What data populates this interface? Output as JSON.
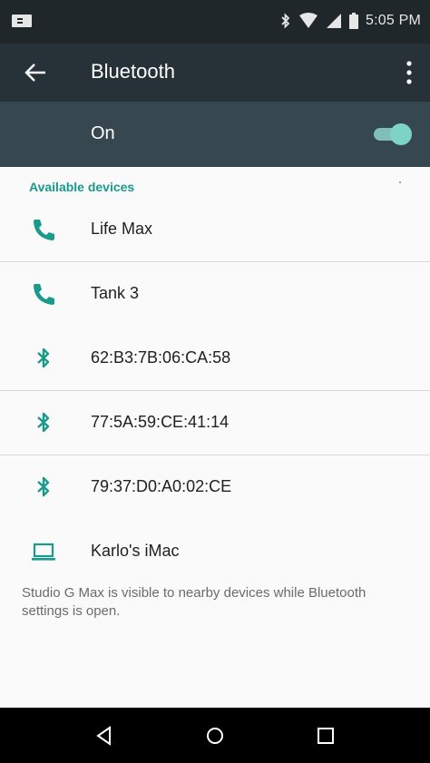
{
  "status_bar": {
    "time": "5:05 PM",
    "icons": [
      "notification-icon",
      "bluetooth-icon",
      "wifi-icon",
      "signal-icon",
      "battery-icon"
    ]
  },
  "app_bar": {
    "title": "Bluetooth",
    "back_icon": "arrow-back-icon",
    "menu_icon": "more-vert-icon"
  },
  "master_switch": {
    "label": "On",
    "checked": true
  },
  "section_header": "Available devices",
  "devices": [
    {
      "name": "Life Max",
      "icon": "phone-icon"
    },
    {
      "name": "Tank 3",
      "icon": "phone-icon"
    },
    {
      "name": "62:B3:7B:06:CA:58",
      "icon": "bluetooth-icon"
    },
    {
      "name": "77:5A:59:CE:41:14",
      "icon": "bluetooth-icon"
    },
    {
      "name": "79:37:D0:A0:02:CE",
      "icon": "bluetooth-icon"
    },
    {
      "name": "Karlo's iMac",
      "icon": "laptop-icon"
    }
  ],
  "footer_text": "Studio G Max is visible to nearby devices while Bluetooth settings is open.",
  "nav_bar": {
    "back": "nav-back-icon",
    "home": "nav-home-icon",
    "recents": "nav-recents-icon"
  },
  "colors": {
    "accent": "#1a9a8c",
    "app_bar": "#263238",
    "switch_bar": "#37474f",
    "status_bar": "#1f272b"
  }
}
